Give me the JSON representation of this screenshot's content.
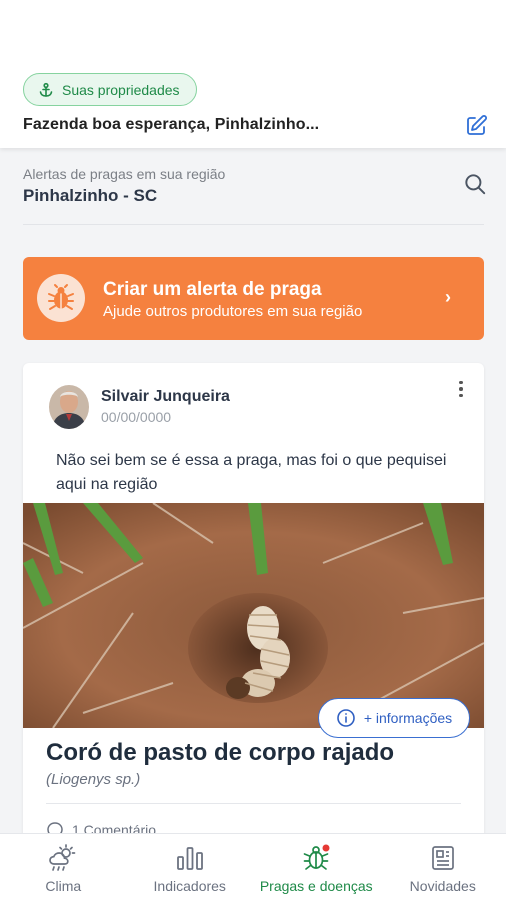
{
  "header": {
    "properties_chip": "Suas propriedades",
    "farm_name": "Fazenda boa esperança, Pinhalzinho..."
  },
  "region": {
    "label": "Alertas de pragas em sua região",
    "name": "Pinhalzinho - SC"
  },
  "alert_cta": {
    "title": "Criar um alerta de praga",
    "subtitle": "Ajude outros produtores em sua região"
  },
  "post": {
    "author": "Silvair Junqueira",
    "date": "00/00/0000",
    "text": "Não sei bem se é essa a praga, mas foi o que pequisei aqui na região",
    "info_button": "+ informações",
    "pest_name": "Coró de pasto de corpo rajado",
    "pest_scientific": "(Liogenys sp.)",
    "comments": "1 Comentário"
  },
  "nav": {
    "items": [
      {
        "label": "Clima",
        "icon": "weather-icon"
      },
      {
        "label": "Indicadores",
        "icon": "chart-icon"
      },
      {
        "label": "Pragas e doenças",
        "icon": "bug-icon"
      },
      {
        "label": "Novidades",
        "icon": "news-icon"
      }
    ],
    "active": "Pragas e doenças"
  },
  "colors": {
    "accent_green": "#1f8a48",
    "alert_orange": "#f5813f",
    "link_blue": "#2f5fc2",
    "badge_red": "#e53935"
  }
}
